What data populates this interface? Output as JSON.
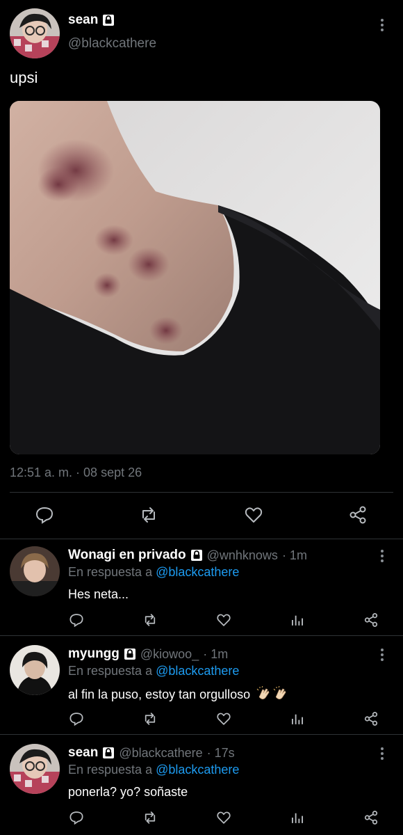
{
  "main_tweet": {
    "name": "sean",
    "handle": "@blackcathere",
    "text": "upsi",
    "timestamp": "12:51 a. m. · 08 sept 26",
    "media_description_icon": "photo",
    "actions": [
      "reply-icon",
      "retweet-icon",
      "like-icon",
      "share-icon"
    ]
  },
  "replies": [
    {
      "name": "Wonagi en privado",
      "handle": "@wnhknows",
      "time": "· 1m",
      "in_reply_prefix": "En respuesta a ",
      "in_reply_mention": "@blackcathere",
      "text": "Hes neta..."
    },
    {
      "name": "myungg",
      "handle": "@kiowoo_",
      "time": "· 1m",
      "in_reply_prefix": "En respuesta a ",
      "in_reply_mention": "@blackcathere",
      "text": "al fin la puso, estoy tan orgulloso",
      "emojis": [
        "clapping-hands-icon",
        "clapping-hands-icon"
      ]
    },
    {
      "name": "sean",
      "handle": "@blackcathere",
      "time": "· 17s",
      "in_reply_prefix": "En respuesta a ",
      "in_reply_mention": "@blackcathere",
      "text": "ponerla? yo? soñaste"
    }
  ],
  "colors": {
    "background": "#000000",
    "text": "#ffffff",
    "secondary": "#71767b",
    "mention": "#1d9bf0",
    "divider": "#2f3336"
  }
}
